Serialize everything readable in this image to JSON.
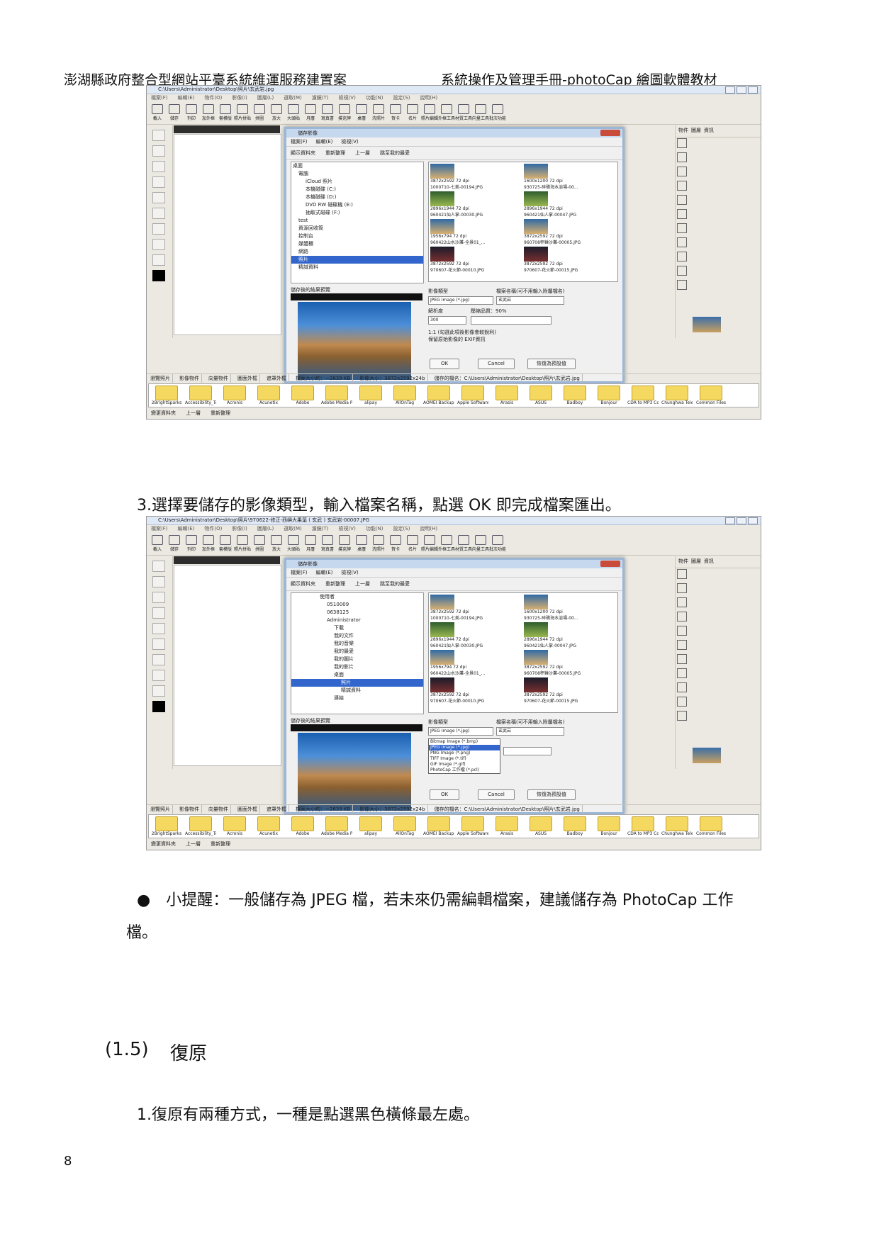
{
  "header": {
    "left": "澎湖縣政府整合型網站平臺系統維運服務建置案",
    "right": "系統操作及管理手冊-photoCap 繪圖軟體教材"
  },
  "screenshot1": {
    "window_title": "C:\\Users\\Administrator\\Desktop\\照片\\玄武岩.jpg",
    "menu": [
      "檔案(F)",
      "編輯(E)",
      "物件(O)",
      "影像(I)",
      "圖層(L)",
      "選取(M)",
      "濾鏡(T)",
      "檢視(V)",
      "功能(N)",
      "設定(S)",
      "說明(H)"
    ],
    "toolbar": [
      "載入",
      "儲存",
      "列印",
      "加外框",
      "套模版",
      "照片拼貼",
      "拼圖",
      "放大",
      "大頭貼",
      "月曆",
      "寫真書",
      "撲克牌",
      "桌曆",
      "洗照片",
      "賀卡",
      "名片",
      "照片編輯",
      "外框工具",
      "材質工具",
      "向量工具",
      "批次功能"
    ],
    "right_tabs": [
      "物件",
      "圖層",
      "資訊"
    ],
    "dialog": {
      "title": "儲存影像",
      "menu": [
        "檔案(F)",
        "編輯(E)",
        "檢視(V)"
      ],
      "tools": [
        "顯示資料夾",
        "重新整理",
        "上一層",
        "跳至我的最愛"
      ],
      "tree": [
        "桌面",
        "電腦",
        "iCloud 照片",
        "本機磁碟 (C:)",
        "本機磁碟 (D:)",
        "DVD RW 磁碟機 (E:)",
        "抽取式磁碟 (F:)",
        "test",
        "資源回收筒",
        "控制台",
        "媒體櫃",
        "網路",
        "照片",
        "精誠資料"
      ],
      "thumbs": [
        {
          "info": "3872x2592 72 dpi",
          "name": "1000710-七美-00194.JPG"
        },
        {
          "info": "1600x1200 72 dpi",
          "name": "930725-碎礁海水浴場-00..."
        },
        {
          "info": "2896x1944 72 dpi",
          "name": "960421仙人掌-00030.JPG"
        },
        {
          "info": "2896x1944 72 dpi",
          "name": "960421仙人掌-00047.JPG"
        },
        {
          "info": "1956x794 72 dpi",
          "name": "960422山水沙灘-全景01_..."
        },
        {
          "info": "3872x2592 72 dpi",
          "name": "960708秤錘沙灘-00005.JPG"
        },
        {
          "info": "3872x2592 72 dpi",
          "name": "970607-花火節-00010.JPG"
        },
        {
          "info": "3872x2592 72 dpi",
          "name": "970607-花火節-00015.JPG"
        }
      ],
      "preview_label": "儲存後的結果預覽",
      "type_label": "影像類型",
      "filename_label": "檔案名稱(可不用輸入附屬檔名)",
      "type_value": "JPEG Image (*.jpg)",
      "filename_value": "玄武岩",
      "resolution_label": "解析度",
      "resolution_value": "300",
      "quality_label": "壓縮品質：90%",
      "option1": "1:1 (勾選此項後影像會較銳利)",
      "option2": "保留原始影像的 EXIF資訊",
      "ok": "OK",
      "cancel": "Cancel",
      "reset": "恢復為預設值"
    },
    "status": [
      "檔案大小約：~2639 KB",
      "影像大小：3872x2592x24b",
      "儲存的檔名：C:\\Users\\Administrator\\Desktop\\照片\\玄武岩.jpg"
    ],
    "panel_tabs": [
      "瀏覽照片",
      "影像物件",
      "向量物件",
      "圖面外框",
      "遮罩外框"
    ],
    "folders": [
      "2BrightSparks",
      "Accessibility_Toolb",
      "Acronis",
      "Acunetix",
      "Adobe",
      "Adobe Media Player",
      "alipay",
      "AllOnTag",
      "AOMEI Backupper",
      "Apple Software Update",
      "Arasis",
      "ASUS",
      "Badboy",
      "Bonjour",
      "CDA to MP3 Converter 3",
      "Chunghwa Telecom",
      "Common Files"
    ],
    "bottom": [
      "變更資料夾",
      "上一層",
      "重新整理"
    ]
  },
  "screenshot2": {
    "window_title": "C:\\Users\\Administrator\\Desktop\\照片\\970622-修正-西嶼大果葉 ( 玄武 ) 玄武岩-00007.JPG",
    "tree": [
      "使用者",
      "0510009",
      "0638125",
      "Administrator",
      "下載",
      "我的文件",
      "我的音樂",
      "我的最愛",
      "我的圖片",
      "我的影片",
      "桌面",
      "照片",
      "精誠資料",
      "連結"
    ],
    "dropdown": [
      "Bitmap Image (*.bmp)",
      "JPEG Image (*.jpg)",
      "PNG Image (*.png)",
      "TIFF Image (*.tif)",
      "GIF Image (*.gif)",
      "PhotoCap 工作檔 (*.pcl)"
    ],
    "dropdown_selected": 1
  },
  "body": {
    "step3": "3.選擇要儲存的影像類型，輸入檔案名稱，點選 OK 即完成檔案匯出。",
    "tip_line1": "●　小提醒：一般儲存為 JPEG 檔，若未來仍需編輯檔案，建議儲存為 PhotoCap 工作",
    "tip_line2": "檔。",
    "section_number": "(1.5)",
    "section_title": "復原",
    "step1": "1.復原有兩種方式，一種是點選黑色橫條最左處。"
  },
  "page_number": "8"
}
